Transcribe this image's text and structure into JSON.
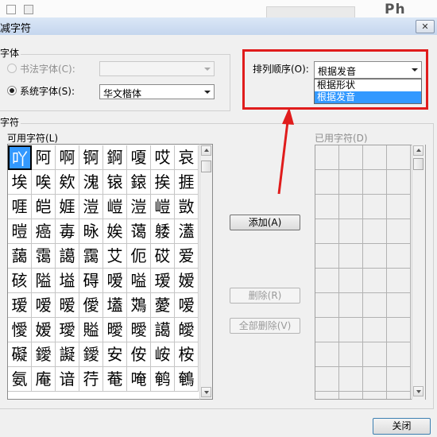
{
  "window": {
    "title": "减字符",
    "close_glyph": "✕"
  },
  "font_group": {
    "title": "字体",
    "calligraphy_label": "书法字体(C):",
    "calligraphy_value": "",
    "system_label": "系统字体(S):",
    "system_value": "华文楷体",
    "selected": "system"
  },
  "sort": {
    "label": "排列顺序(O):",
    "value": "根据发音",
    "options": [
      {
        "label": "根据形状",
        "selected": false
      },
      {
        "label": "根据发音",
        "selected": true
      }
    ]
  },
  "chars_group": {
    "title": "字符",
    "available_label": "可用字符(L)",
    "used_label": "已用字符(D)"
  },
  "available_chars": [
    [
      "吖",
      "阿",
      "啊",
      "锕",
      "錒",
      "嗄",
      "哎",
      "哀"
    ],
    [
      "埃",
      "唉",
      "欸",
      "溾",
      "锿",
      "鎄",
      "挨",
      "捱"
    ],
    [
      "啀",
      "皑",
      "娾",
      "溰",
      "嵦",
      "溰",
      "嵦",
      "敳"
    ],
    [
      "暟",
      "癌",
      "毐",
      "昹",
      "娭",
      "蔼",
      "躷",
      "濭"
    ],
    [
      "藹",
      "霭",
      "譪",
      "靄",
      "艾",
      "伌",
      "砹",
      "爱"
    ],
    [
      "硋",
      "隘",
      "塧",
      "碍",
      "嗳",
      "嗌",
      "瑷",
      "嫒"
    ],
    [
      "瑷",
      "嗳",
      "暧",
      "僾",
      "壒",
      "鴱",
      "薆",
      "嗳"
    ],
    [
      "懓",
      "嫒",
      "璦",
      "賹",
      "曖",
      "曖",
      "譪",
      "皧"
    ],
    [
      "礙",
      "鑀",
      "譺",
      "鑀",
      "安",
      "侒",
      "峖",
      "桉"
    ],
    [
      "氨",
      "庵",
      "谙",
      "荇",
      "菴",
      "唵",
      "鹌",
      "鵪"
    ]
  ],
  "buttons": {
    "add": "添加(A)",
    "delete": "删除(R)",
    "delete_all": "全部删除(V)",
    "close": "关闭"
  },
  "background_text": "Ph",
  "colors": {
    "highlight": "#e01c1c",
    "selection": "#3399ff"
  }
}
